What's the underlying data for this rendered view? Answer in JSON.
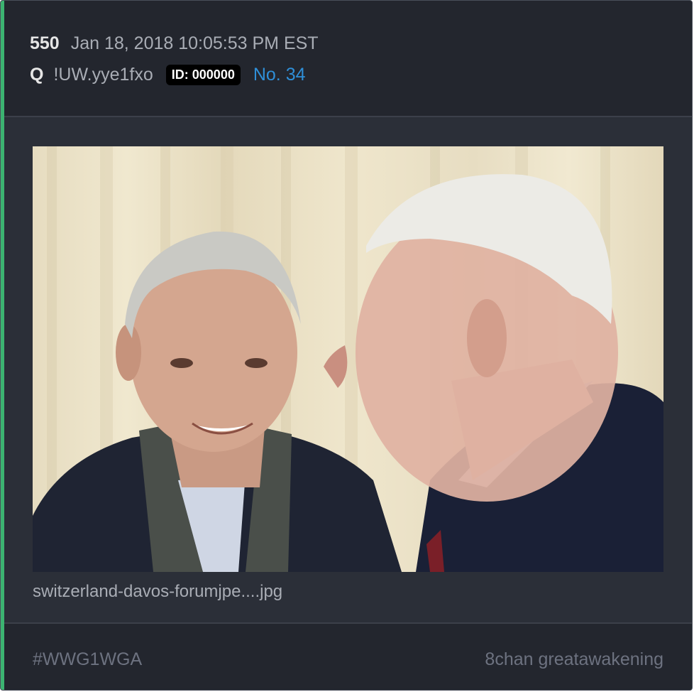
{
  "post": {
    "number": "550",
    "timestamp": "Jan 18, 2018 10:05:53 PM EST",
    "author": "Q",
    "tripcode": "!UW.yye1fxo",
    "id_badge": "ID: 000000",
    "post_link": "No. 34"
  },
  "attachment": {
    "filename": "switzerland-davos-forumjpe....jpg"
  },
  "footer": {
    "hashtag": "#WWG1WGA",
    "source": "8chan greatawakening"
  },
  "colors": {
    "accent": "#3cb371",
    "link": "#2f8fd8",
    "background": "#2b2f38"
  }
}
